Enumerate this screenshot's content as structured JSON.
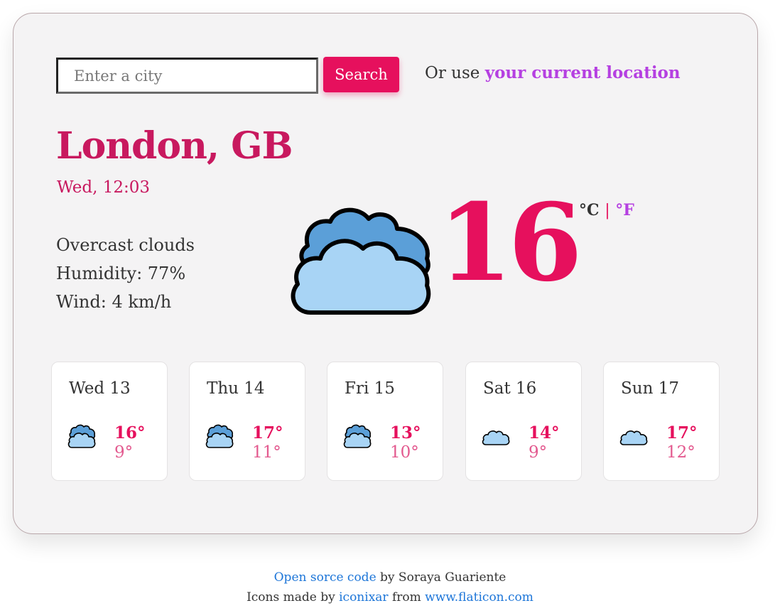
{
  "search": {
    "placeholder": "Enter a city",
    "button_label": "Search",
    "location_prefix": "Or use",
    "location_link": "your current location"
  },
  "current": {
    "city": "London, GB",
    "datetime": "Wed, 12:03",
    "description": "Overcast clouds",
    "humidity": "Humidity: 77%",
    "wind": "Wind: 4 km/h",
    "temperature": "16",
    "unit_celsius": "°C",
    "unit_separator": "|",
    "unit_fahrenheit": "°F",
    "icon": "broken-clouds-icon"
  },
  "forecast": [
    {
      "day": "Wed 13",
      "max": "16°",
      "min": "9°",
      "icon": "broken-clouds-icon"
    },
    {
      "day": "Thu 14",
      "max": "17°",
      "min": "11°",
      "icon": "broken-clouds-icon"
    },
    {
      "day": "Fri 15",
      "max": "13°",
      "min": "10°",
      "icon": "broken-clouds-icon"
    },
    {
      "day": "Sat 16",
      "max": "14°",
      "min": "9°",
      "icon": "cloud-icon"
    },
    {
      "day": "Sun 17",
      "max": "17°",
      "min": "12°",
      "icon": "cloud-icon"
    }
  ],
  "footer": {
    "source_link": "Open sorce code",
    "author_text": "by Soraya Guariente",
    "icons_prefix": "Icons made by",
    "icons_author_link": "iconixar",
    "icons_from": "from",
    "icons_site_link": "www.flaticon.com"
  },
  "colors": {
    "accent": "#e6105d",
    "city": "#c8195f",
    "purple": "#b540e1",
    "link_blue": "#1c75d8",
    "cloud_light": "#a8d4f5",
    "cloud_dark": "#5b9fd8"
  }
}
